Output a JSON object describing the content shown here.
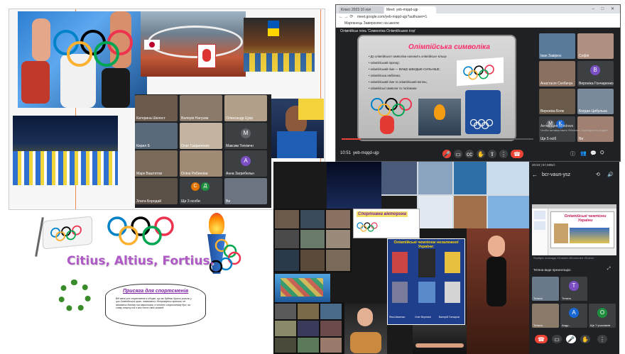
{
  "meet_left": {
    "tiles": [
      {
        "name": "Катерина Шелест"
      },
      {
        "name": "Валерія Нагуєва"
      },
      {
        "name": "Олександр Цукр"
      },
      {
        "name": "Кирил Б"
      },
      {
        "name": "Олег Гавриленко"
      },
      {
        "name": "Максим Тепличн",
        "initial": "M"
      },
      {
        "name": "Марк Ваштетов"
      },
      {
        "name": "Оліна Рибинова"
      },
      {
        "name": "Анна Загребельн",
        "initial": "A"
      },
      {
        "name": "Злата Бородай"
      },
      {
        "name": "Ще 3 особи",
        "initials": [
          "С",
          "Д"
        ]
      },
      {
        "name": "Ви"
      }
    ]
  },
  "browser": {
    "tabs": [
      "Класс 2023 10 кол",
      "Meet: yeb-mqqd-ujp"
    ],
    "url": "meet.google.com/yeb-mqqd-ujp?authuser=1",
    "bookmarks": "Марганець Заверхнянс на школи",
    "presenter_label": "Олімпійськ гкінь 'Символіка Олімпійських ігор'",
    "time": "10:51",
    "code": "yeb-mqqd-ujp",
    "slide": {
      "title": "Олімпійська символіка",
      "bullets": [
        "До олімпійської символіки належить олімпійське кільце",
        "олімпійський прапор;",
        "олімпійський гімн — ВИЩЕ-ШВИДШЕ-СИЛЬНІШЕ;",
        "олімпійська емблема;",
        "олімпійський гімн та олімпійський вогонь;",
        "олімпійські символи та талісмани"
      ]
    },
    "participants": [
      {
        "name": "Іван Завірюх"
      },
      {
        "name": "Софія"
      },
      {
        "name": "Анастасія Скобачук"
      },
      {
        "name": "Вероніка Гончаренко",
        "initial": "B"
      },
      {
        "name": "Вероніка Бояк"
      },
      {
        "name": "Богдан Цибулька"
      },
      {
        "name": "Ще 5 осіб",
        "initials": [
          "M",
          "K"
        ]
      },
      {
        "name": "Ви"
      }
    ],
    "activate": {
      "line1": "Активация Windows",
      "line2": "Чтобы активировать Windows, перейдите в раздел"
    }
  },
  "poster": {
    "motto": "Citius, Altius, Fortius.",
    "oath_title": "Присяга для спортсменів",
    "oath_text": "Від імені усіх спортсменів я обіцяю, що ми будемо брати участь у цих Олімпійських іграх, поважаючи і дотримуючи правила, не вживаючи допінгу та наркотиків, в істинно спортивному дусі, на славу спорту та в ім'я честі своїх команд."
  },
  "collage": {
    "banner": "Спортивна вікторина",
    "slide2_title": "Олімпійські чемпіони незалежної України:",
    "champions": [
      "Яна Шеменко",
      "Олег Верняєв",
      "Валерій Гончаров"
    ]
  },
  "phone": {
    "code": "bcr-vaun-ysz",
    "status_left": "20:53 | 67,8КБ/с",
    "slide_title": "Олімпійські чемпіони України",
    "hint": "Перейдіть на вкладку «Основне» або натисніть «Почати»",
    "presenting": "Тетяна веде презентацію",
    "tiles": [
      {
        "name": "Тетяна"
      },
      {
        "name": "Тетяна",
        "initial": "T"
      },
      {
        "name": "Тетяна"
      },
      {
        "name": "Андр...",
        "initial": "A"
      },
      {
        "name": "Ще 7 учасників",
        "initial": "O"
      }
    ]
  },
  "colors": {
    "ring_blue": "#0081c8",
    "ring_yellow": "#fcb131",
    "ring_black": "#000000",
    "ring_green": "#00a651",
    "ring_red": "#ee334e",
    "meet_dark": "#202124",
    "end_call": "#ea4335"
  }
}
